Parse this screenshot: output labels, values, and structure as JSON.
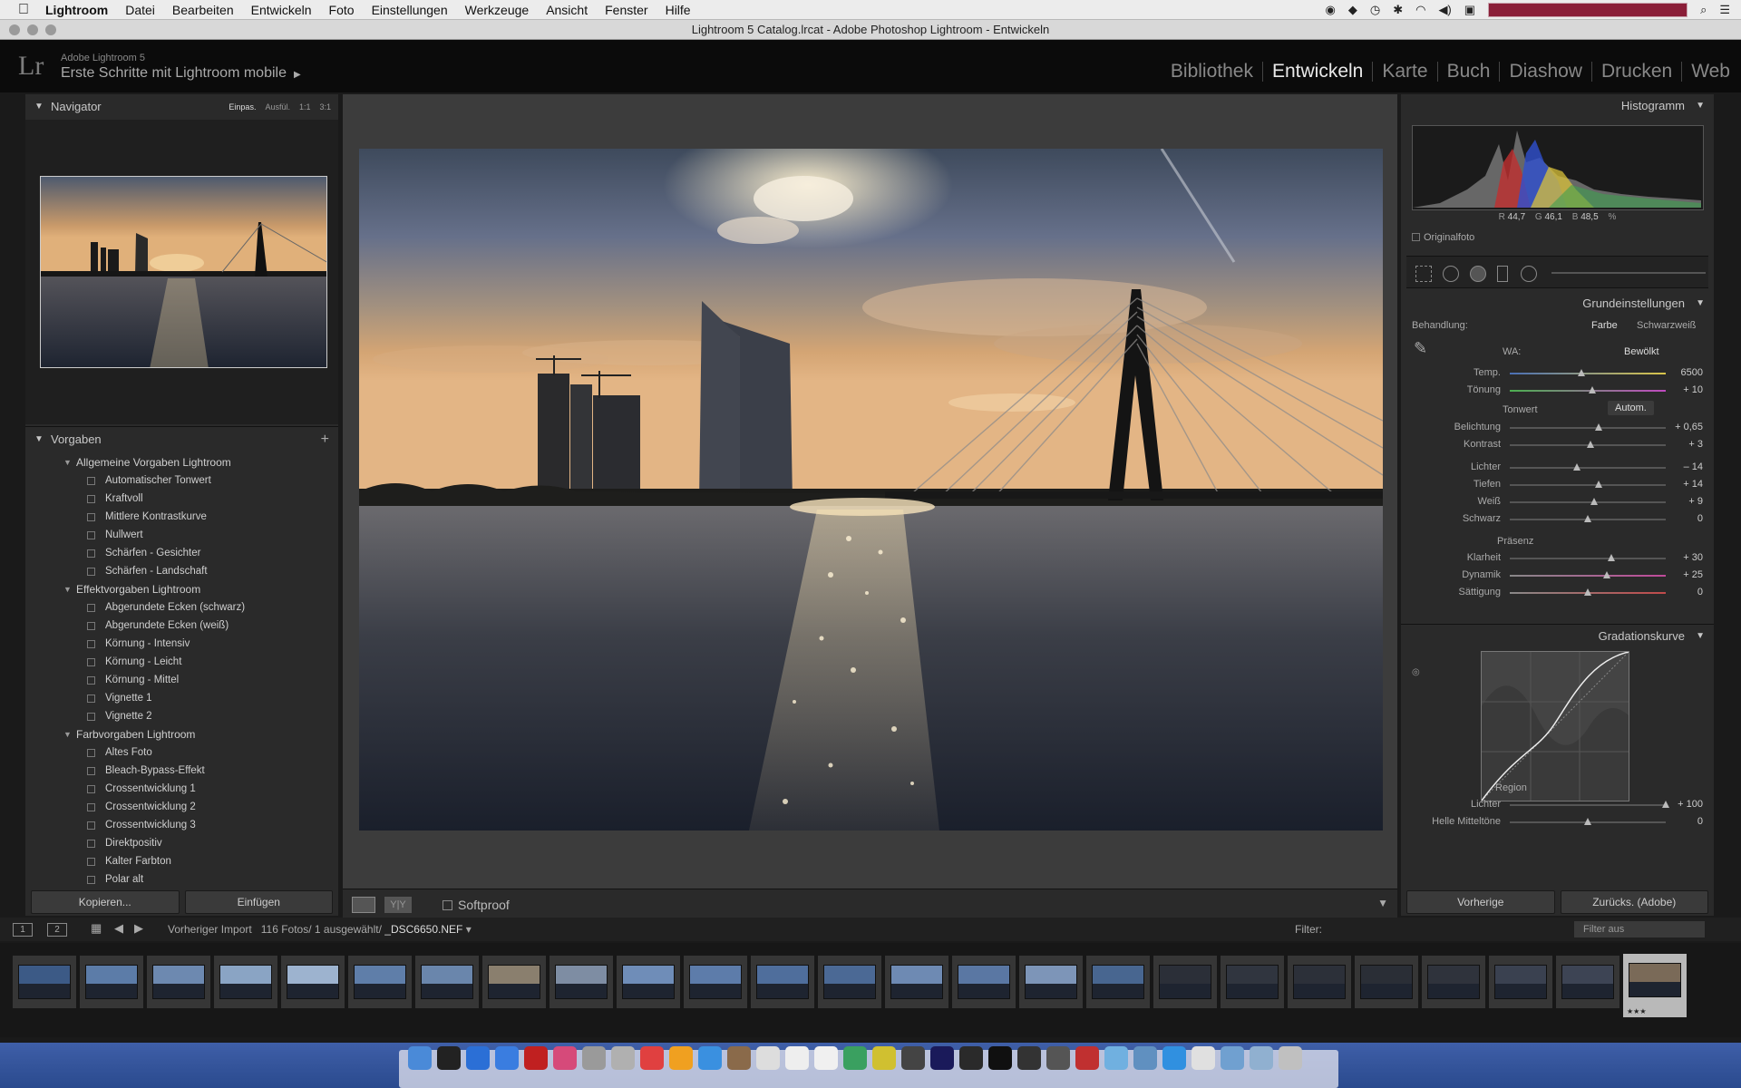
{
  "menubar": {
    "app": "Lightroom",
    "items": [
      "Datei",
      "Bearbeiten",
      "Entwickeln",
      "Foto",
      "Einstellungen",
      "Werkzeuge",
      "Ansicht",
      "Fenster",
      "Hilfe"
    ]
  },
  "window": {
    "title": "Lightroom 5 Catalog.lrcat - Adobe Photoshop Lightroom - Entwickeln"
  },
  "identity": {
    "logo": "Lr",
    "version": "Adobe Lightroom 5",
    "subtitle": "Erste Schritte mit Lightroom mobile"
  },
  "modules": [
    "Bibliothek",
    "Entwickeln",
    "Karte",
    "Buch",
    "Diashow",
    "Drucken",
    "Web"
  ],
  "navigator": {
    "title": "Navigator",
    "options": [
      "Einpas.",
      "Ausfül.",
      "1:1",
      "3:1"
    ]
  },
  "presets": {
    "title": "Vorgaben",
    "groups": [
      {
        "name": "Allgemeine Vorgaben Lightroom",
        "items": [
          "Automatischer Tonwert",
          "Kraftvoll",
          "Mittlere Kontrastkurve",
          "Nullwert",
          "Schärfen - Gesichter",
          "Schärfen - Landschaft"
        ]
      },
      {
        "name": "Effektvorgaben Lightroom",
        "items": [
          "Abgerundete Ecken (schwarz)",
          "Abgerundete Ecken (weiß)",
          "Körnung - Intensiv",
          "Körnung - Leicht",
          "Körnung - Mittel",
          "Vignette 1",
          "Vignette 2"
        ]
      },
      {
        "name": "Farbvorgaben Lightroom",
        "items": [
          "Altes Foto",
          "Bleach-Bypass-Effekt",
          "Crossentwicklung 1",
          "Crossentwicklung 2",
          "Crossentwicklung 3",
          "Direktpositiv",
          "Kalter Farbton",
          "Polar alt"
        ]
      }
    ]
  },
  "left_buttons": {
    "copy": "Kopieren...",
    "paste": "Einfügen"
  },
  "toolbar": {
    "softproof": "Softproof",
    "yy": "Y|Y"
  },
  "histogram": {
    "title": "Histogramm",
    "r_label": "R",
    "r": "44,7",
    "g_label": "G",
    "g": "46,1",
    "b_label": "B",
    "b": "48,5",
    "unit": "%",
    "original": "Originalfoto"
  },
  "basic": {
    "title": "Grundeinstellungen",
    "treatment_label": "Behandlung:",
    "treatment_color": "Farbe",
    "treatment_bw": "Schwarzweiß",
    "wb_label": "WA:",
    "wb_value": "Bewölkt",
    "sliders_wb": [
      {
        "label": "Temp.",
        "value": "6500",
        "pos": 0.46
      },
      {
        "label": "Tönung",
        "value": "+ 10",
        "pos": 0.53
      }
    ],
    "tone_label": "Tonwert",
    "auto": "Autom.",
    "sliders_tone": [
      {
        "label": "Belichtung",
        "value": "+ 0,65",
        "pos": 0.57
      },
      {
        "label": "Kontrast",
        "value": "+ 3",
        "pos": 0.52
      }
    ],
    "sliders_tone2": [
      {
        "label": "Lichter",
        "value": "– 14",
        "pos": 0.43
      },
      {
        "label": "Tiefen",
        "value": "+ 14",
        "pos": 0.57
      },
      {
        "label": "Weiß",
        "value": "+ 9",
        "pos": 0.54
      },
      {
        "label": "Schwarz",
        "value": "0",
        "pos": 0.5
      }
    ],
    "presence_label": "Präsenz",
    "sliders_presence": [
      {
        "label": "Klarheit",
        "value": "+ 30",
        "pos": 0.65
      },
      {
        "label": "Dynamik",
        "value": "+ 25",
        "pos": 0.62
      },
      {
        "label": "Sättigung",
        "value": "0",
        "pos": 0.5
      }
    ]
  },
  "curve": {
    "title": "Gradationskurve",
    "region_label": "Region",
    "sliders": [
      {
        "label": "Lichter",
        "value": "+ 100",
        "pos": 1.0
      },
      {
        "label": "Helle Mitteltöne",
        "value": "0",
        "pos": 0.5
      }
    ]
  },
  "right_buttons": {
    "previous": "Vorherige",
    "reset": "Zurücks. (Adobe)"
  },
  "filmstrip_bar": {
    "screen1": "1",
    "screen2": "2",
    "source": "Vorheriger Import",
    "count": "116 Fotos/",
    "selected": "1 ausgewählt/",
    "filename": "_DSC6650.NEF",
    "filter_label": "Filter:",
    "filter_value": "Filter aus"
  },
  "filmstrip": {
    "selected_stars": "★★★"
  }
}
